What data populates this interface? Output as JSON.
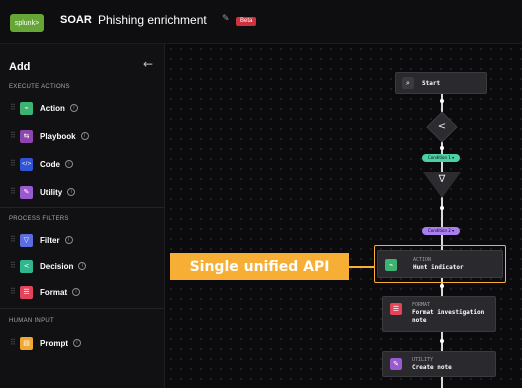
{
  "header": {
    "logo_text": "splunk>",
    "app_name": "SOAR",
    "playbook_title": "Phishing enrichment",
    "badge": "Beta"
  },
  "sidebar": {
    "title": "Add",
    "sections": [
      {
        "label": "EXECUTE ACTIONS",
        "items": [
          "Action",
          "Playbook",
          "Code",
          "Utility"
        ]
      },
      {
        "label": "PROCESS FILTERS",
        "items": [
          "Filter",
          "Decision",
          "Format"
        ]
      },
      {
        "label": "HUMAN INPUT",
        "items": [
          "Prompt"
        ]
      }
    ]
  },
  "canvas": {
    "start_label": "Start",
    "condition_1": "Condition 1",
    "condition_2": "Condition 2",
    "action_node": {
      "type": "ACTION",
      "name": "Hunt indicator"
    },
    "format_node": {
      "type": "FORMAT",
      "name": "Format investigation note"
    },
    "utility_node": {
      "type": "UTILITY",
      "name": "Create note"
    }
  },
  "annotation": {
    "text": "Single unified API"
  },
  "colors": {
    "action": "#3cb371",
    "playbook": "#8e44ad",
    "code": "#2f55d4",
    "utility": "#9b59d0",
    "filter": "#5b6ee1",
    "decision": "#2fb68e",
    "format": "#e2455a",
    "prompt": "#f0a830",
    "callout": "#f6ae35",
    "condition_1": "#4dd0a5",
    "condition_2": "#a97ef0"
  }
}
